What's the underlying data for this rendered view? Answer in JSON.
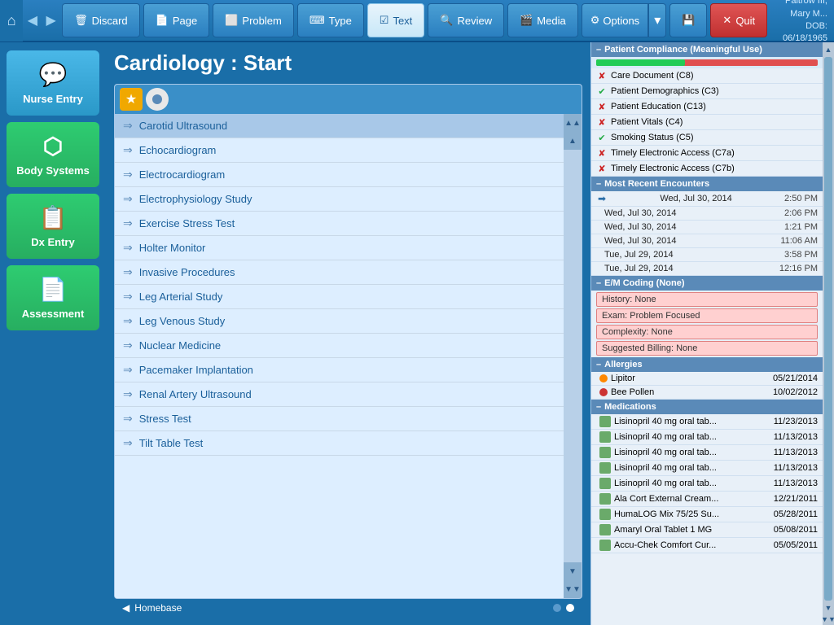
{
  "header": {
    "title": "Cardiology : Start",
    "user_name": "Paltrow III, Mary M...",
    "user_dob_label": "DOB:",
    "user_dob": "06/18/1965"
  },
  "toolbar": {
    "discard_label": "Discard",
    "page_label": "Page",
    "problem_label": "Problem",
    "type_label": "Type",
    "text_label": "Text",
    "review_label": "Review",
    "media_label": "Media",
    "options_label": "Options",
    "quit_label": "Quit",
    "home_icon": "⌂",
    "nav_back": "◀",
    "nav_forward": "▶"
  },
  "sidebar": {
    "items": [
      {
        "id": "nurse-entry",
        "label": "Nurse Entry",
        "icon": "💬"
      },
      {
        "id": "body-systems",
        "label": "Body Systems",
        "icon": "⬡"
      },
      {
        "id": "dx-entry",
        "label": "Dx Entry",
        "icon": "📋"
      },
      {
        "id": "assessment",
        "label": "Assessment",
        "icon": "📄"
      }
    ]
  },
  "procedures": {
    "items": [
      "Carotid Ultrasound",
      "Echocardiogram",
      "Electrocardiogram",
      "Electrophysiology Study",
      "Exercise Stress Test",
      "Holter Monitor",
      "Invasive Procedures",
      "Leg Arterial Study",
      "Leg Venous Study",
      "Nuclear Medicine",
      "Pacemaker Implantation",
      "Renal Artery Ultrasound",
      "Stress Test",
      "Tilt Table Test"
    ],
    "selected_index": 0
  },
  "bottom_bar": {
    "homebase_label": "Homebase",
    "dots": [
      false,
      true
    ]
  },
  "right_panel": {
    "compliance_header": "Patient Compliance (Meaningful Use)",
    "compliance_items": [
      {
        "checked": false,
        "label": "Care Document (C8)"
      },
      {
        "checked": true,
        "label": "Patient Demographics (C3)"
      },
      {
        "checked": false,
        "label": "Patient Education (C13)"
      },
      {
        "checked": false,
        "label": "Patient Vitals (C4)"
      },
      {
        "checked": true,
        "label": "Smoking Status (C5)"
      },
      {
        "checked": false,
        "label": "Timely Electronic Access (C7a)"
      },
      {
        "checked": false,
        "label": "Timely Electronic Access (C7b)"
      }
    ],
    "encounters_header": "Most Recent Encounters",
    "encounters": [
      {
        "date": "Wed, Jul 30, 2014",
        "time": "2:50 PM",
        "active": true
      },
      {
        "date": "Wed, Jul 30, 2014",
        "time": "2:06 PM",
        "active": false
      },
      {
        "date": "Wed, Jul 30, 2014",
        "time": "1:21 PM",
        "active": false
      },
      {
        "date": "Wed, Jul 30, 2014",
        "time": "11:06 AM",
        "active": false
      },
      {
        "date": "Tue, Jul 29, 2014",
        "time": "3:58 PM",
        "active": false
      },
      {
        "date": "Tue, Jul 29, 2014",
        "time": "12:16 PM",
        "active": false
      }
    ],
    "em_header": "E/M Coding (None)",
    "em_items": [
      "History: None",
      "Exam: Problem Focused",
      "Complexity: None",
      "Suggested Billing: None"
    ],
    "allergies_header": "Allergies",
    "allergies": [
      {
        "name": "Lipitor",
        "date": "05/21/2014",
        "color": "#ff8800"
      },
      {
        "name": "Bee Pollen",
        "date": "10/02/2012",
        "color": "#cc3333"
      }
    ],
    "medications_header": "Medications",
    "medications": [
      {
        "name": "Lisinopril 40 mg oral tab...",
        "date": "11/23/2013"
      },
      {
        "name": "Lisinopril 40 mg oral tab...",
        "date": "11/13/2013"
      },
      {
        "name": "Lisinopril 40 mg oral tab...",
        "date": "11/13/2013"
      },
      {
        "name": "Lisinopril 40 mg oral tab...",
        "date": "11/13/2013"
      },
      {
        "name": "Lisinopril 40 mg oral tab...",
        "date": "11/13/2013"
      },
      {
        "name": "Ala Cort External Cream...",
        "date": "12/21/2011"
      },
      {
        "name": "HumaLOG Mix 75/25 Su...",
        "date": "05/28/2011"
      },
      {
        "name": "Amaryl Oral Tablet 1 MG",
        "date": "05/08/2011"
      },
      {
        "name": "Accu-Chek Comfort Cur...",
        "date": "05/05/2011"
      }
    ]
  }
}
